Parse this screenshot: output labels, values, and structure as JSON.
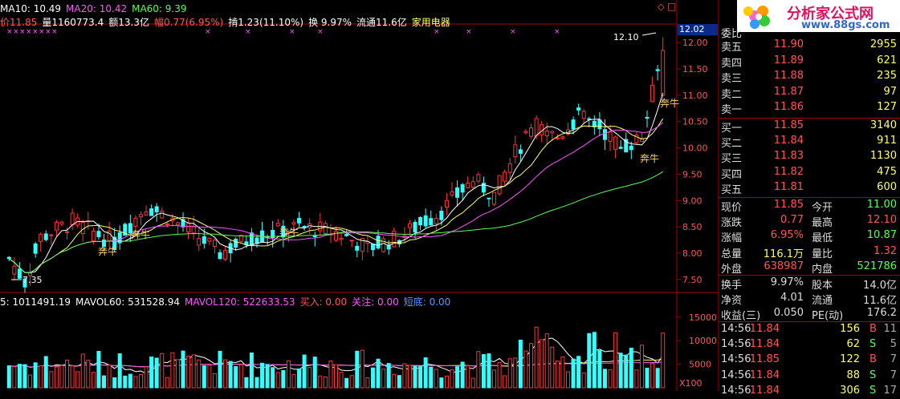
{
  "header": {
    "line1": [
      {
        "text": "MA10: 10.49",
        "color": "#ffffff"
      },
      {
        "text": "MA20: 10.42",
        "color": "#ff55ff"
      },
      {
        "text": "MA60: 9.39",
        "color": "#55ff55"
      }
    ],
    "line2": [
      {
        "text": "价11.85",
        "color": "#ff5555"
      },
      {
        "text": "量1160773.4",
        "color": "#ffffff"
      },
      {
        "text": "额13.3亿",
        "color": "#ffffff"
      },
      {
        "text": "幅0.77(6.95%)",
        "color": "#ff5555"
      },
      {
        "text": "掯1.23(11.10%)",
        "color": "#ffffff"
      },
      {
        "text": "换 9.97%",
        "color": "#ffffff"
      },
      {
        "text": "流通11.6亿",
        "color": "#ffffff"
      },
      {
        "text": "家用电器",
        "color": "#ffff66"
      }
    ],
    "top_right_icons": [
      "◇",
      "□"
    ]
  },
  "vol_header": [
    {
      "text": "5: 1011491.19",
      "color": "#ffffff"
    },
    {
      "text": "MAVOL60: 531528.94",
      "color": "#ffffff"
    },
    {
      "text": "MAVOL120: 522633.53",
      "color": "#ff55ff"
    },
    {
      "text": "买入: 0.00",
      "color": "#ff5555"
    },
    {
      "text": "关注: 0.00",
      "color": "#ff55ff"
    },
    {
      "text": "短底: 0.00",
      "color": "#5599ff"
    }
  ],
  "logo": {
    "title": "分析家公式网",
    "url": "www.88gs.com"
  },
  "price_axis": {
    "ticks": [
      "12.00",
      "11.50",
      "11.00",
      "10.50",
      "10.00",
      "9.50",
      "9.00",
      "8.50",
      "8.00",
      "7.50"
    ],
    "current_box": "12.02"
  },
  "vol_axis": {
    "ticks": [
      "15000",
      "10000",
      "5000"
    ],
    "unit": "X100"
  },
  "annotations": {
    "high": "12.10",
    "low": "7.35",
    "signals": [
      "奔牛",
      "奔牛",
      "奔牛",
      "奔牛",
      "奔牛"
    ]
  },
  "order_book": {
    "title": "委比",
    "asks": [
      {
        "label": "卖五",
        "price": "11.90",
        "vol": "2955"
      },
      {
        "label": "卖四",
        "price": "11.89",
        "vol": "621"
      },
      {
        "label": "卖三",
        "price": "11.88",
        "vol": "235"
      },
      {
        "label": "卖二",
        "price": "11.87",
        "vol": "97"
      },
      {
        "label": "卖一",
        "price": "11.86",
        "vol": "127"
      }
    ],
    "bids": [
      {
        "label": "买一",
        "price": "11.85",
        "vol": "3140"
      },
      {
        "label": "买二",
        "price": "11.84",
        "vol": "911"
      },
      {
        "label": "买三",
        "price": "11.83",
        "vol": "1130"
      },
      {
        "label": "买四",
        "price": "11.82",
        "vol": "475"
      },
      {
        "label": "买五",
        "price": "11.81",
        "vol": "600"
      }
    ]
  },
  "stats": [
    {
      "l1": "现价",
      "v1": "11.85",
      "c1": "#ff5555",
      "l2": "今开",
      "v2": "11.00",
      "c2": "#55ff55"
    },
    {
      "l1": "涨跌",
      "v1": "0.77",
      "c1": "#ff5555",
      "l2": "最高",
      "v2": "12.10",
      "c2": "#ff5555"
    },
    {
      "l1": "涨幅",
      "v1": "6.95%",
      "c1": "#ff5555",
      "l2": "最低",
      "v2": "10.87",
      "c2": "#55ff55"
    },
    {
      "l1": "总量",
      "v1": "116.1万",
      "c1": "#ffff66",
      "l2": "量比",
      "v2": "1.32",
      "c2": "#ff5555"
    },
    {
      "l1": "外盘",
      "v1": "638987",
      "c1": "#ff5555",
      "l2": "内盘",
      "v2": "521786",
      "c2": "#55ff55"
    }
  ],
  "stats2": [
    {
      "l1": "换手",
      "v1": "9.97%",
      "l2": "股本",
      "v2": "14.0亿"
    },
    {
      "l1": "净资",
      "v1": "4.01",
      "l2": "流通",
      "v2": "11.6亿"
    },
    {
      "l1": "收益(三)",
      "v1": "0.050",
      "l2": "PE(动)",
      "v2": "176.2"
    }
  ],
  "ticks": [
    {
      "time": "14:56",
      "price": "11.84",
      "vol": "156",
      "side": "B",
      "num": "11"
    },
    {
      "time": "14:56",
      "price": "11.84",
      "vol": "62",
      "side": "S",
      "num": "5"
    },
    {
      "time": "14:56",
      "price": "11.85",
      "vol": "122",
      "side": "B",
      "num": "7"
    },
    {
      "time": "14:56",
      "price": "11.84",
      "vol": "88",
      "side": "S",
      "num": "7"
    },
    {
      "time": "14:56",
      "price": "11.84",
      "vol": "306",
      "side": "S",
      "num": "17"
    }
  ],
  "chart_data": {
    "type": "candlestick",
    "note_price_range": [
      7.3,
      12.2
    ],
    "summary": {
      "last": 11.85,
      "open": 11.0,
      "high": 12.1,
      "low": 10.87,
      "period_low": 7.35,
      "period_high": 12.1
    },
    "ma_series": [
      {
        "name": "MA10",
        "value": 10.49,
        "color": "#ffffff"
      },
      {
        "name": "MA20",
        "value": 10.42,
        "color": "#ff55ff"
      },
      {
        "name": "MA60",
        "value": 9.39,
        "color": "#55ff55"
      }
    ]
  }
}
